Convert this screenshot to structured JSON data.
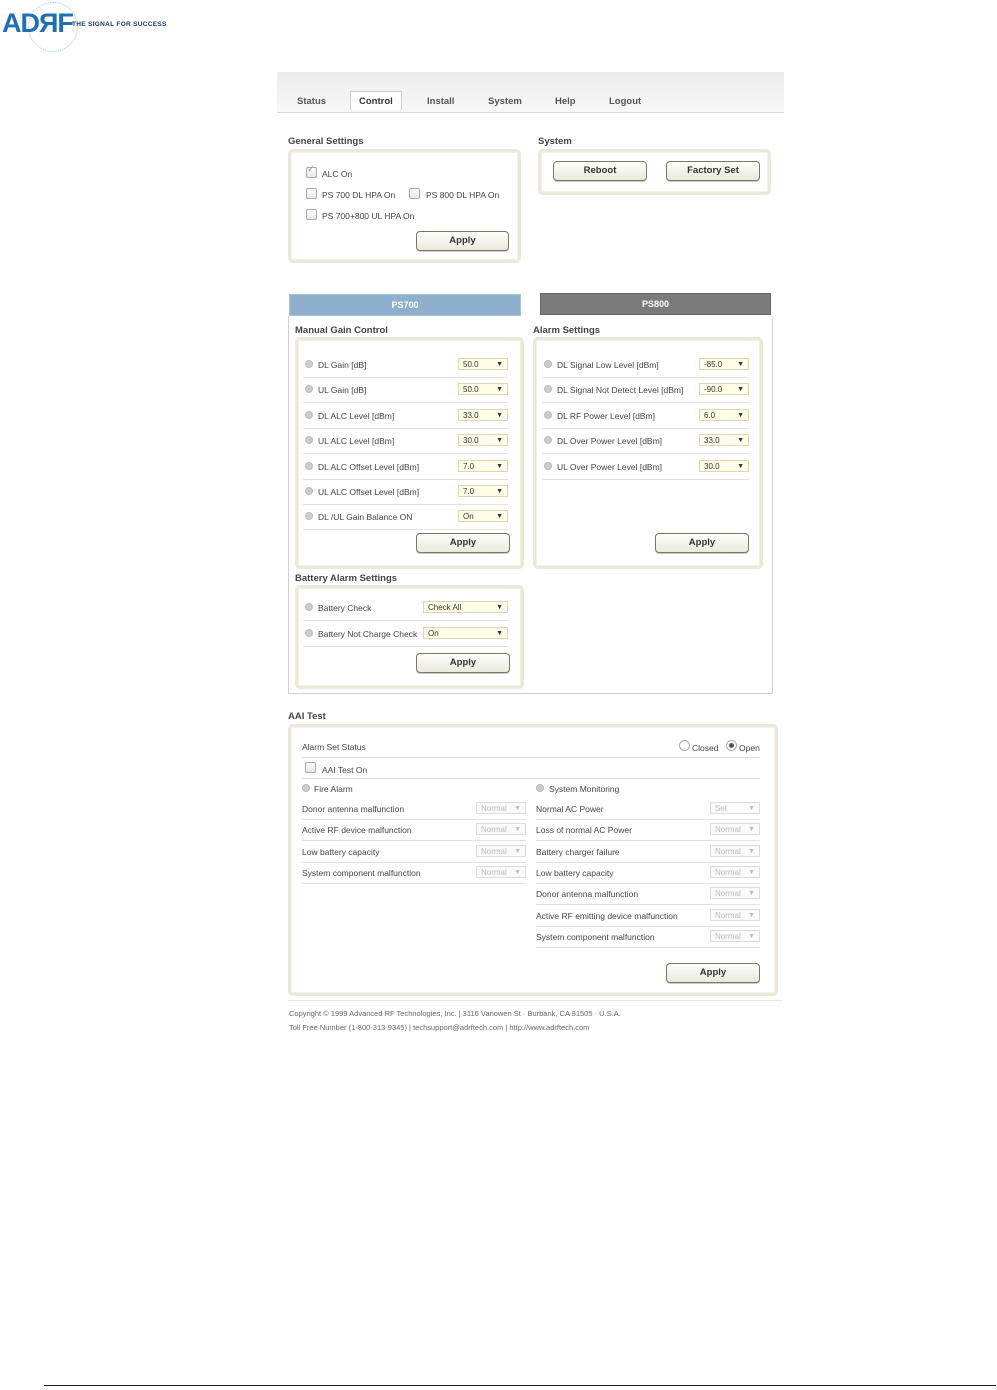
{
  "logo": {
    "brand": "ADЯF",
    "tagline": "THE SIGNAL FOR SUCCESS"
  },
  "nav": {
    "tabs": [
      "Status",
      "Control",
      "Install",
      "System",
      "Help",
      "Logout"
    ],
    "active": "Control"
  },
  "general": {
    "title": "General Settings",
    "alc_on": "ALC On",
    "ps700_dl_hpa": "PS 700 DL HPA On",
    "ps800_dl_hpa": "PS 800 DL HPA On",
    "ps_ul_hpa": "PS 700+800 UL HPA On",
    "apply": "Apply"
  },
  "system": {
    "title": "System",
    "reboot": "Reboot",
    "factory_set": "Factory Set"
  },
  "band_tabs": {
    "ps700": "PS700",
    "ps800": "PS800"
  },
  "manual_gain": {
    "title": "Manual Gain Control",
    "rows": [
      {
        "label": "DL Gain [dB]",
        "value": "50.0"
      },
      {
        "label": "UL Gain [dB]",
        "value": "50.0"
      },
      {
        "label": "DL ALC Level [dBm]",
        "value": "33.0"
      },
      {
        "label": "UL ALC Level [dBm]",
        "value": "30.0"
      },
      {
        "label": "DL ALC Offset Level [dBm]",
        "value": "7.0"
      },
      {
        "label": "UL ALC Offset Level [dBm]",
        "value": "7.0"
      },
      {
        "label": "DL /UL Gain Balance ON",
        "value": "On"
      }
    ],
    "apply": "Apply"
  },
  "alarm_settings": {
    "title": "Alarm Settings",
    "rows": [
      {
        "label": "DL Signal Low Level [dBm]",
        "value": "-85.0"
      },
      {
        "label": "DL Signal Not Detect Level [dBm]",
        "value": "-90.0"
      },
      {
        "label": "DL RF Power Level [dBm]",
        "value": "6.0"
      },
      {
        "label": "DL Over Power Level [dBm]",
        "value": "33.0"
      },
      {
        "label": "UL Over Power Level [dBm]",
        "value": "30.0"
      }
    ],
    "apply": "Apply"
  },
  "battery": {
    "title": "Battery Alarm Settings",
    "rows": [
      {
        "label": "Battery Check",
        "value": "Check All"
      },
      {
        "label": "Battery Not Charge Check",
        "value": "On"
      }
    ],
    "apply": "Apply"
  },
  "aai": {
    "title": "AAI Test",
    "alarm_set_status": "Alarm Set Status",
    "closed": "Closed",
    "open": "Open",
    "test_on": "AAI Test On",
    "fire_alarm": "Fire Alarm",
    "system_monitoring": "System Monitoring",
    "fire_rows": [
      {
        "label": "Donor antenna malfunction",
        "value": "Normal"
      },
      {
        "label": "Active RF device malfunction",
        "value": "Normal"
      },
      {
        "label": "Low battery capacity",
        "value": "Normal"
      },
      {
        "label": "System component malfunction",
        "value": "Normal"
      }
    ],
    "sys_rows": [
      {
        "label": "Normal AC Power",
        "value": "Set"
      },
      {
        "label": "Loss of normal AC Power",
        "value": "Normal"
      },
      {
        "label": "Battery charger failure",
        "value": "Normal"
      },
      {
        "label": "Low battery capacity",
        "value": "Normal"
      },
      {
        "label": "Donor antenna malfunction",
        "value": "Normal"
      },
      {
        "label": "Active RF emitting device malfunction",
        "value": "Normal"
      },
      {
        "label": "System component malfunction",
        "value": "Normal"
      }
    ],
    "apply": "Apply"
  },
  "footer": {
    "line1": "Copyright © 1999 Advanced RF Technologies, Inc. | 3116 Vanowen St · Burbank, CA 91505 · U.S.A.",
    "line2": "Toll Free Number (1-800-313-9345) | techsupport@adrftech.com | http://www.adrftech.com"
  },
  "colors": {
    "ps700_tab": "#8fb0cc",
    "ps800_tab": "#7b7b7b",
    "box_border": "#ebe8d8",
    "select_bg": "#fffde8"
  }
}
